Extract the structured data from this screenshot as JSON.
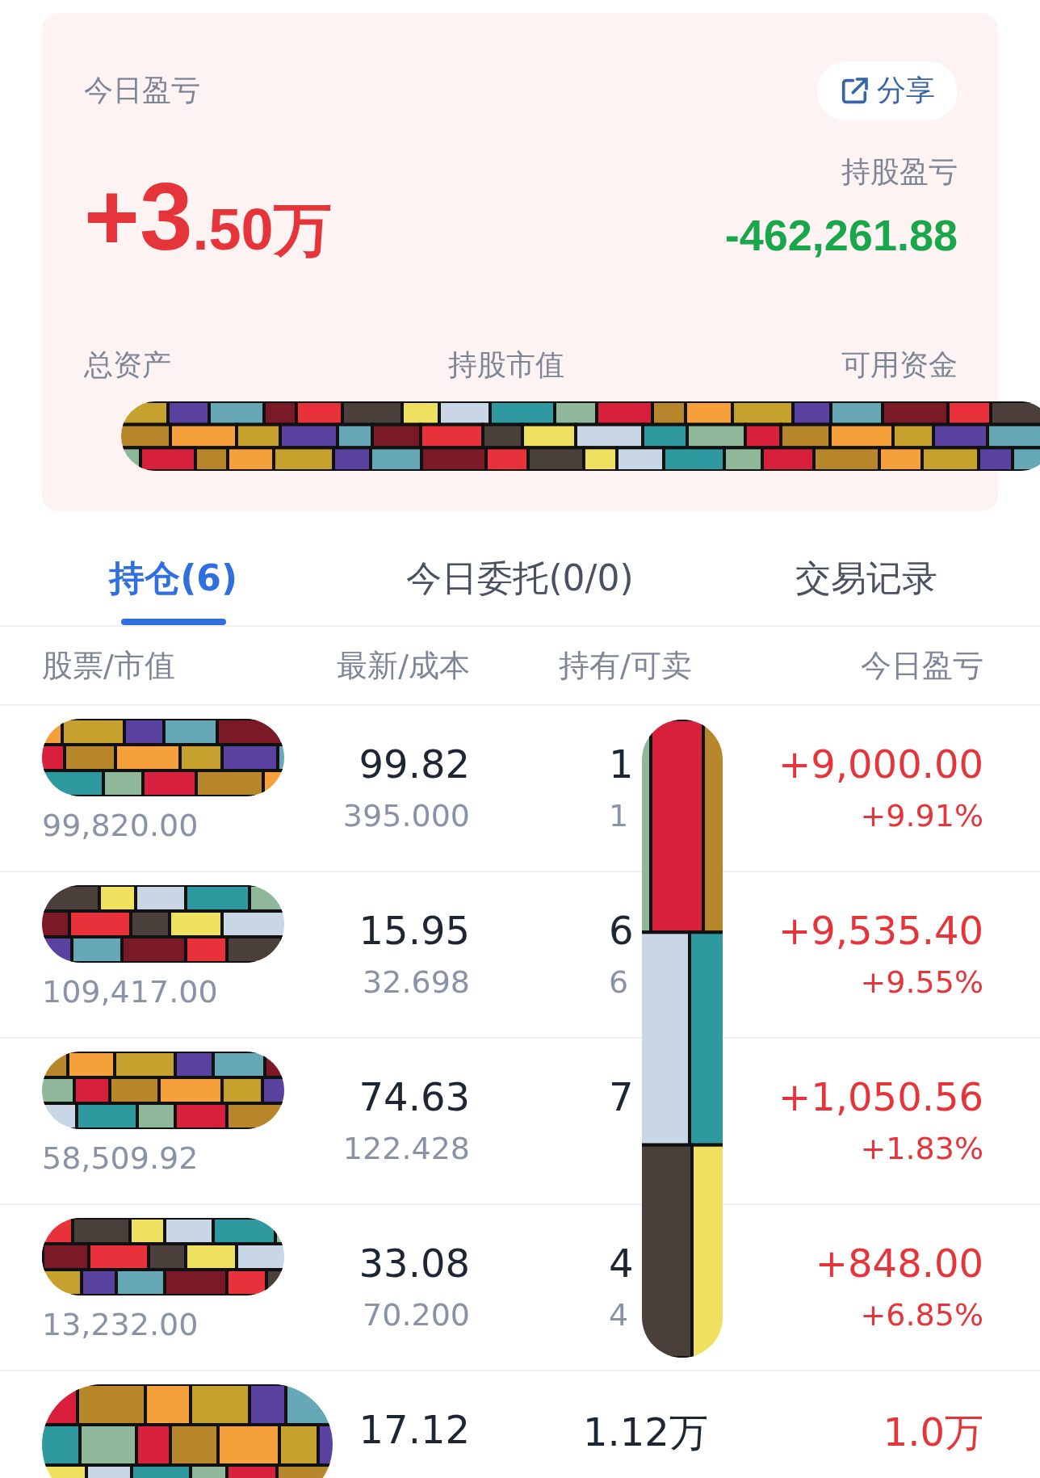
{
  "summary": {
    "title": "今日盈亏",
    "share_button": "分享",
    "today_pnl_main": "+3",
    "today_pnl_rest": ".50万",
    "holding_pnl_label": "持股盈亏",
    "holding_pnl": "-462,261.88",
    "asset_labels": [
      "总资产",
      "持股市值",
      "可用资金"
    ]
  },
  "tabs": [
    {
      "label": "持仓(6)",
      "selected": true
    },
    {
      "label": "今日委托(0/0)",
      "selected": false
    },
    {
      "label": "交易记录",
      "selected": false
    }
  ],
  "columns": [
    "股票/市值",
    "最新/成本",
    "持有/可卖",
    "今日盈亏"
  ],
  "rows": [
    {
      "market_value": "99,820.00",
      "price": "99.82",
      "cost": "395.000",
      "held": "1",
      "sellable": "1",
      "pnl": "+9,000.00",
      "pnl_pct": "+9.91%"
    },
    {
      "market_value": "109,417.00",
      "price": "15.95",
      "cost": "32.698",
      "held": "6",
      "sellable": "6",
      "pnl": "+9,535.40",
      "pnl_pct": "+9.55%"
    },
    {
      "market_value": "58,509.92",
      "price": "74.63",
      "cost": "122.428",
      "held": "7",
      "pnl": "+1,050.56",
      "pnl_pct": "+1.83%"
    },
    {
      "market_value": "13,232.00",
      "price": "33.08",
      "cost": "70.200",
      "held": "4",
      "sellable": "4",
      "pnl": "+848.00",
      "pnl_pct": "+6.85%"
    },
    {
      "price": "17.12",
      "held": "1.12万",
      "pnl": "1.0万"
    }
  ]
}
